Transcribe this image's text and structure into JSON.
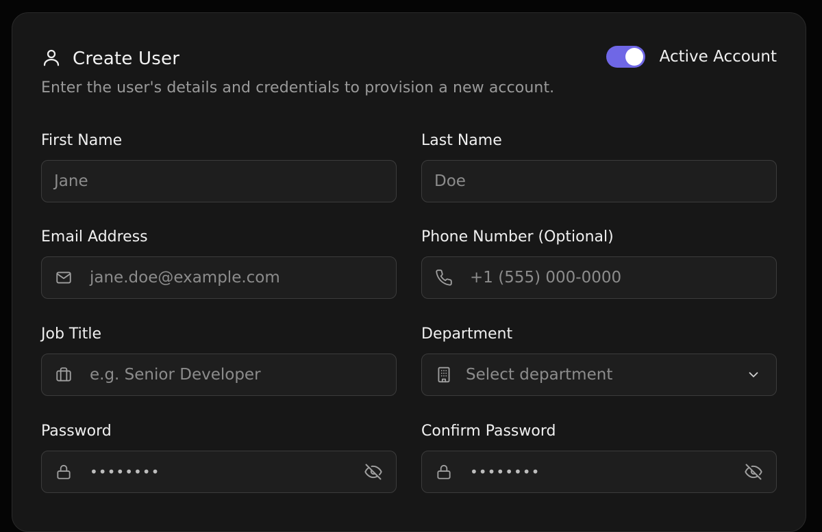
{
  "header": {
    "title": "Create User",
    "title_icon": "user-icon",
    "toggle_label": "Active Account",
    "toggle_on": true,
    "subtitle": "Enter the user's details and credentials to provision a new account."
  },
  "fields": {
    "first_name": {
      "label": "First Name",
      "placeholder": "Jane"
    },
    "last_name": {
      "label": "Last Name",
      "placeholder": "Doe"
    },
    "email": {
      "label": "Email Address",
      "placeholder": "jane.doe@example.com",
      "icon": "mail-icon"
    },
    "phone": {
      "label": "Phone Number (Optional)",
      "placeholder": "+1 (555) 000-0000",
      "icon": "phone-icon"
    },
    "job_title": {
      "label": "Job Title",
      "placeholder": "e.g. Senior Developer",
      "icon": "briefcase-icon"
    },
    "department": {
      "label": "Department",
      "placeholder": "Select department",
      "icon": "building-icon"
    },
    "password": {
      "label": "Password",
      "value": "••••••••",
      "icon": "lock-icon"
    },
    "confirm_password": {
      "label": "Confirm Password",
      "value": "••••••••",
      "icon": "lock-icon"
    }
  },
  "colors": {
    "background": "#050505",
    "card": "#171717",
    "input": "#1e1e1e",
    "border": "#3c3c3c",
    "accent": "#6f67e6",
    "muted_text": "#8c8c8c"
  }
}
